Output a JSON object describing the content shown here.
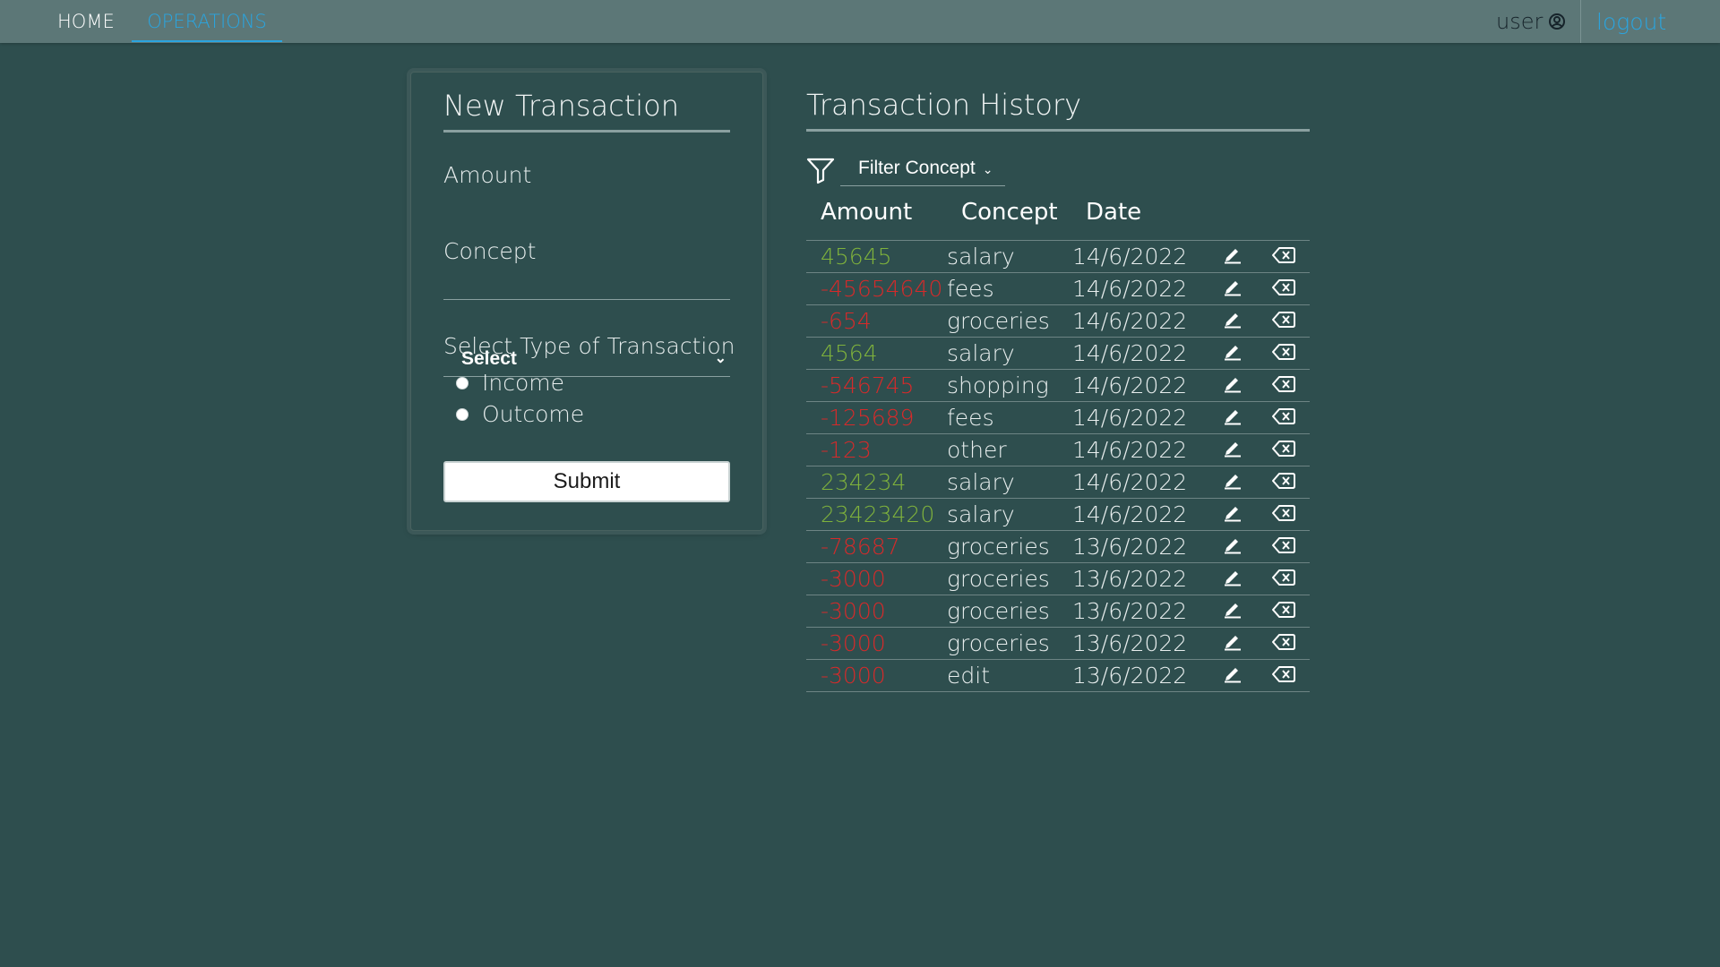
{
  "nav": {
    "home": "HOME",
    "operations": "OPERATIONS",
    "user": "user",
    "logout": "logout"
  },
  "new_transaction": {
    "title": "New Transaction",
    "amount_label": "Amount",
    "amount_value": "",
    "concept_label": "Concept",
    "concept_selected": "Select",
    "type_label": "Select Type of Transaction",
    "types": [
      "Income",
      "Outcome"
    ],
    "submit": "Submit"
  },
  "history": {
    "title": "Transaction History",
    "filter_label": "Filter Concept",
    "columns": [
      "Amount",
      "Concept",
      "Date"
    ],
    "rows": [
      {
        "amount": "45645",
        "concept": "salary",
        "date": "14/6/2022",
        "sign": "pos"
      },
      {
        "amount": "-45654640",
        "concept": "fees",
        "date": "14/6/2022",
        "sign": "neg"
      },
      {
        "amount": "-654",
        "concept": "groceries",
        "date": "14/6/2022",
        "sign": "neg"
      },
      {
        "amount": "4564",
        "concept": "salary",
        "date": "14/6/2022",
        "sign": "pos"
      },
      {
        "amount": "-546745",
        "concept": "shopping",
        "date": "14/6/2022",
        "sign": "neg"
      },
      {
        "amount": "-125689",
        "concept": "fees",
        "date": "14/6/2022",
        "sign": "neg"
      },
      {
        "amount": "-123",
        "concept": "other",
        "date": "14/6/2022",
        "sign": "neg"
      },
      {
        "amount": "234234",
        "concept": "salary",
        "date": "14/6/2022",
        "sign": "pos"
      },
      {
        "amount": "23423420",
        "concept": "salary",
        "date": "14/6/2022",
        "sign": "pos"
      },
      {
        "amount": "-78687",
        "concept": "groceries",
        "date": "13/6/2022",
        "sign": "neg"
      },
      {
        "amount": "-3000",
        "concept": "groceries",
        "date": "13/6/2022",
        "sign": "neg"
      },
      {
        "amount": "-3000",
        "concept": "groceries",
        "date": "13/6/2022",
        "sign": "neg"
      },
      {
        "amount": "-3000",
        "concept": "groceries",
        "date": "13/6/2022",
        "sign": "neg"
      },
      {
        "amount": "-3000",
        "concept": "edit",
        "date": "13/6/2022",
        "sign": "neg"
      }
    ]
  },
  "icons": {
    "user": "user-circle-icon",
    "filter": "filter-funnel-icon",
    "edit": "pencil-icon",
    "delete": "backspace-delete-icon"
  },
  "colors": {
    "background": "#2e4e4e",
    "navbar": "#5c7777",
    "accent": "#2aa5e0",
    "income": "#7fb23c",
    "outcome": "#d62a2a"
  }
}
